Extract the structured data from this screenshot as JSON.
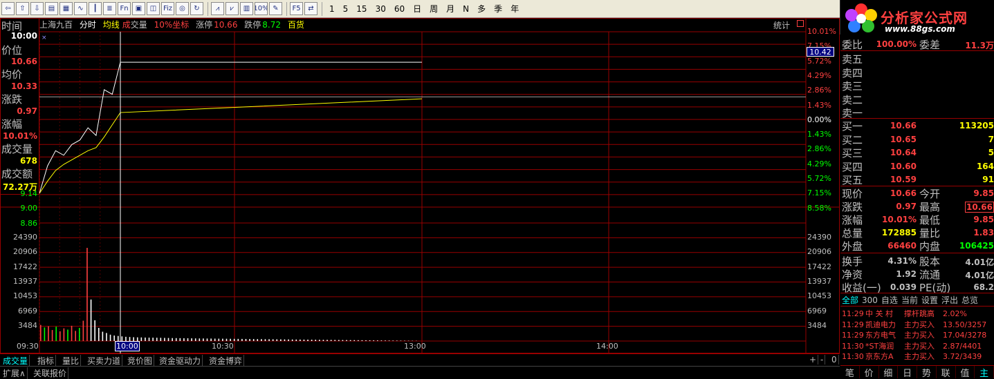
{
  "toolbar": {
    "icons": [
      "back-arrow-icon",
      "up-arrow-icon",
      "down-arrow-icon",
      "tick-chart-icon",
      "table-icon",
      "minute-chart-icon",
      "kline-icon",
      "report-icon",
      "fin-icon",
      "f10-icon",
      "brokerage-icon",
      "fiz-icon",
      "f10-circle-icon",
      "refresh-icon",
      "index-chart-icon",
      "volume-chart-icon",
      "indicator-chart-icon",
      "percent-icon",
      "draw-pen-icon",
      "f5-icon",
      "switch-icon"
    ],
    "icon_glyphs": {
      "fin": "Fn",
      "fiz": "Fiz",
      "percent": "10%",
      "f5": "F5"
    },
    "periods": [
      "1",
      "5",
      "15",
      "30",
      "60",
      "日",
      "周",
      "月",
      "N",
      "多",
      "季",
      "年"
    ]
  },
  "logo": {
    "text": "分析家公式网",
    "url": "www.88gs.com"
  },
  "header": {
    "stock": "上海九百",
    "mode": "分时",
    "avg": "均线",
    "vol_a": "成",
    "vol_b": "交量",
    "coord": "10%坐标",
    "limit_up_lbl": "涨停",
    "limit_up": "10.66",
    "limit_down_lbl": "跌停",
    "limit_down": "8.72",
    "index": "百货",
    "stats": "统计"
  },
  "info": {
    "time_lbl": "时间",
    "time": "10:00",
    "price_lbl": "价位",
    "price": "10.66",
    "avg_lbl": "均价",
    "avg": "10.33",
    "chg_lbl": "涨跌",
    "chg": "0.97",
    "pct_lbl": "涨幅",
    "pct": "10.01%",
    "vol_lbl": "成交量",
    "vol": "678",
    "amt_lbl": "成交额",
    "amt": "72.27万"
  },
  "price_axis_left": [
    "9.14",
    "9.00",
    "8.86"
  ],
  "price_axis_right": [
    "10.01%",
    "7.15%",
    "5.72%",
    "4.29%",
    "2.86%",
    "1.43%",
    "0.00%",
    "1.43%",
    "2.86%",
    "4.29%",
    "5.72%",
    "7.15%",
    "8.58%"
  ],
  "cursor_price": "10.42",
  "vol_axis": [
    "24390",
    "20906",
    "17422",
    "13937",
    "10453",
    "6969",
    "3484"
  ],
  "time_axis": [
    "09:30",
    "10:00",
    "10:30",
    "13:00",
    "14:00"
  ],
  "bottom_tabs": [
    "成交量",
    "指标",
    "量比",
    "买卖力道",
    "竞价图",
    "资金驱动力",
    "资金博弈"
  ],
  "bottom_ctrl": [
    "+",
    "-",
    "0"
  ],
  "bottom2": [
    "扩展∧",
    "关联报价"
  ],
  "orderbook": {
    "weibi_lbl": "委比",
    "weibi": "100.00%",
    "weicha_lbl": "委差",
    "weicha": "11.3万",
    "sells": [
      {
        "label": "卖五"
      },
      {
        "label": "卖四"
      },
      {
        "label": "卖三"
      },
      {
        "label": "卖二"
      },
      {
        "label": "卖一"
      }
    ],
    "buys": [
      {
        "label": "买一",
        "price": "10.66",
        "vol": "113205"
      },
      {
        "label": "买二",
        "price": "10.65",
        "vol": "7"
      },
      {
        "label": "买三",
        "price": "10.64",
        "vol": "5"
      },
      {
        "label": "买四",
        "price": "10.60",
        "vol": "164"
      },
      {
        "label": "买五",
        "price": "10.59",
        "vol": "91"
      }
    ]
  },
  "quote": [
    {
      "l1": "现价",
      "v1": "10.66",
      "l2": "今开",
      "v2": "9.85",
      "c1": "#ff4040",
      "c2": "#ff4040"
    },
    {
      "l1": "涨跌",
      "v1": "0.97",
      "l2": "最高",
      "v2": "10.66",
      "c1": "#ff4040",
      "c2": "#ff4040"
    },
    {
      "l1": "涨幅",
      "v1": "10.01%",
      "l2": "最低",
      "v2": "9.85",
      "c1": "#ff4040",
      "c2": "#ff4040"
    },
    {
      "l1": "总量",
      "v1": "172885",
      "l2": "量比",
      "v2": "1.83",
      "c1": "#ffff00",
      "c2": "#ff4040"
    },
    {
      "l1": "外盘",
      "v1": "66460",
      "l2": "内盘",
      "v2": "106425",
      "c1": "#ff4040",
      "c2": "#00ff00"
    },
    {
      "l1": "换手",
      "v1": "4.31%",
      "l2": "股本",
      "v2": "4.01亿",
      "c1": "#c0c0c0",
      "c2": "#c0c0c0"
    },
    {
      "l1": "净资",
      "v1": "1.92",
      "l2": "流通",
      "v2": "4.01亿",
      "c1": "#c0c0c0",
      "c2": "#c0c0c0"
    },
    {
      "l1": "收益(一)",
      "v1": "0.039",
      "l2": "PE(动)",
      "v2": "68.2",
      "c1": "#c0c0c0",
      "c2": "#c0c0c0"
    }
  ],
  "news_tabs": [
    "全部",
    "300",
    "自选",
    "当前",
    "设置",
    "浮出",
    "总览"
  ],
  "news": [
    {
      "time": "11:29",
      "name": "中 关 村",
      "action": "撑杆跳高",
      "value": "2.02%"
    },
    {
      "time": "11:29",
      "name": "凯迪电力",
      "action": "主力买入",
      "value": "13.50/3257"
    },
    {
      "time": "11:29",
      "name": "东方电气",
      "action": "主力买入",
      "value": "17.04/3278"
    },
    {
      "time": "11:30",
      "name": "*ST海润",
      "action": "主力买入",
      "value": "2.87/4401"
    },
    {
      "time": "11:30",
      "name": "京东方A",
      "action": "主力买入",
      "value": "3.72/3439"
    }
  ],
  "rp_bottom": [
    "笔",
    "价",
    "细",
    "日",
    "势",
    "联",
    "值",
    "主"
  ],
  "colors": {
    "up": "#ff4040",
    "down": "#00ff00",
    "grid": "#990000",
    "price_line": "#ffffff",
    "avg_line": "#ffff00",
    "label": "#c0c0c0"
  },
  "chart_data": {
    "type": "line",
    "title": "上海九百 分时",
    "x": [
      "09:30",
      "09:33",
      "09:36",
      "09:39",
      "09:42",
      "09:45",
      "09:48",
      "09:51",
      "09:54",
      "09:57",
      "10:00"
    ],
    "series": [
      {
        "name": "价位",
        "values": [
          9.8,
          9.98,
          10.08,
          10.05,
          10.12,
          10.15,
          10.23,
          10.18,
          10.48,
          10.45,
          10.66
        ]
      },
      {
        "name": "均价",
        "values": [
          9.8,
          9.88,
          9.95,
          9.99,
          10.02,
          10.05,
          10.08,
          10.1,
          10.17,
          10.25,
          10.33
        ]
      }
    ],
    "limit_after": {
      "x_start": "10:00",
      "x_end": "13:00",
      "price": 10.66,
      "avg_end": 10.42
    },
    "volume": [
      3800,
      3200,
      3500,
      2600,
      3400,
      2300,
      3000,
      2700,
      3600,
      2400,
      3100,
      4800,
      22000,
      9800,
      4900,
      3100,
      2200,
      1900,
      1500,
      1300,
      1200,
      1100,
      1000,
      950,
      900,
      870,
      850,
      820,
      800,
      790,
      780,
      760,
      740,
      720,
      700,
      690,
      680,
      660,
      650,
      640,
      620,
      610,
      600,
      590,
      580,
      570,
      560,
      550,
      540,
      530,
      520,
      510,
      500,
      490,
      480,
      470,
      460,
      450,
      440,
      430,
      420,
      410,
      400,
      390,
      380,
      370,
      360,
      350,
      340,
      330,
      320,
      310,
      300,
      290,
      280,
      270,
      260,
      250,
      240,
      230,
      220,
      210,
      200,
      190,
      180,
      170,
      160,
      150,
      140,
      130,
      120,
      110,
      100,
      90,
      80,
      70,
      60,
      50
    ],
    "ylim": [
      8.72,
      10.66
    ],
    "vol_ylim": [
      0,
      27874
    ]
  }
}
